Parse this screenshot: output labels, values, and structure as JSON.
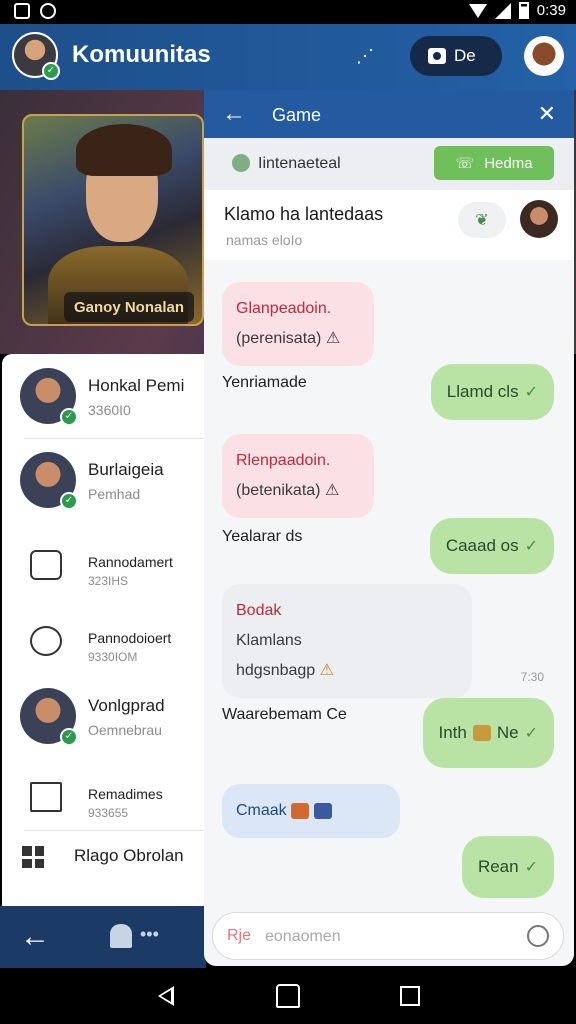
{
  "status_bar": {
    "time": "0:39"
  },
  "app_header": {
    "title": "Komuunitas",
    "pill_label": "De"
  },
  "hero": {
    "label": "Ganoy Nonalan"
  },
  "sidebar": {
    "items": [
      {
        "title": "Honkal Pemi",
        "subtitle": "3360I0"
      },
      {
        "title": "Burlaigeia",
        "subtitle": "Pemhad"
      },
      {
        "title": "Rannodamert",
        "subtitle": "323IHS"
      },
      {
        "title": "Pannodoioert",
        "subtitle": "9330IOM"
      },
      {
        "title": "Vonlgprad",
        "subtitle": "Oemnebrau"
      },
      {
        "title": "Remadimes",
        "subtitle": "933655"
      }
    ],
    "last_item": "Rlago Obrolan"
  },
  "chat": {
    "title": "Game",
    "filter_label": "Iintenaeteal",
    "filter_button": "Hedma",
    "contact_name": "Klamo ha lantedaas",
    "contact_sub": "namas eloIo",
    "messages": [
      {
        "header": "Glanpeadoin.",
        "body": "(perenisata) ⚠"
      },
      {
        "sender": "Yenriamade",
        "reply": "Llamd cls"
      },
      {
        "header": "Rlenpaadoin.",
        "body": "(betenikata) ⚠"
      },
      {
        "sender": "Yealarar ds",
        "reply": "Caaad os"
      },
      {
        "header": "Bodak",
        "body1": "Klamlans",
        "body2": "hdgsnbagp",
        "time": "7:30"
      },
      {
        "sender": "Waarebemam Ce",
        "reply": "Inth",
        "reply2": "Ne"
      },
      {
        "blue_text": "Cmaak",
        "reply": "Rean"
      }
    ],
    "input_prefix": "Rje",
    "input_placeholder": "eonaomen"
  }
}
